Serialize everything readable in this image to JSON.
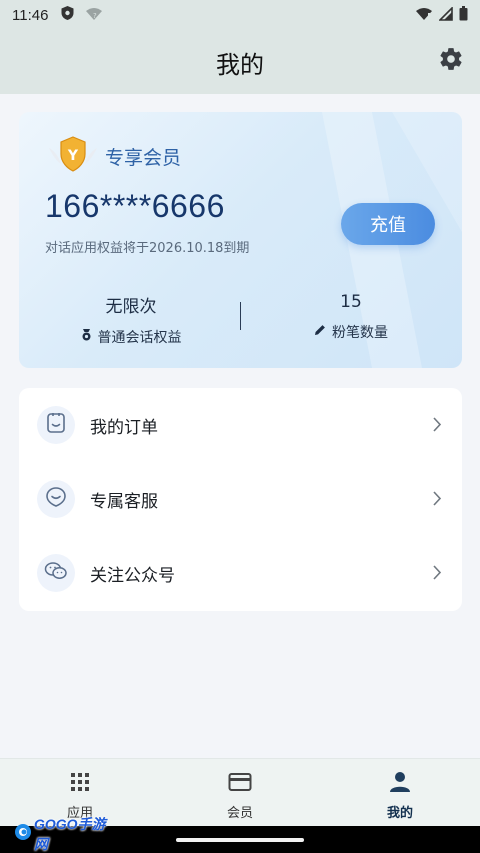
{
  "status_bar": {
    "time": "11:46"
  },
  "header": {
    "title": "我的"
  },
  "member_card": {
    "badge_label": "专享会员",
    "phone": "166****6666",
    "expiry_text": "对话应用权益将于2026.10.18到期",
    "recharge_label": "充值",
    "stats": [
      {
        "value": "无限次",
        "label": "普通会话权益",
        "icon": "medal-icon"
      },
      {
        "value": "15",
        "label": "粉笔数量",
        "icon": "pencil-icon"
      }
    ]
  },
  "menu": [
    {
      "label": "我的订单",
      "icon": "order-icon"
    },
    {
      "label": "专属客服",
      "icon": "service-icon"
    },
    {
      "label": "关注公众号",
      "icon": "wechat-icon"
    }
  ],
  "bottom_nav": [
    {
      "label": "应用",
      "icon": "grid-icon",
      "active": false
    },
    {
      "label": "会员",
      "icon": "card-icon",
      "active": false
    },
    {
      "label": "我的",
      "icon": "person-icon",
      "active": true
    }
  ],
  "watermark": {
    "text": "GOGO手游网"
  },
  "colors": {
    "accent": "#4b8ce0",
    "header_bg": "#dde6e4",
    "active_nav": "#13304f"
  }
}
